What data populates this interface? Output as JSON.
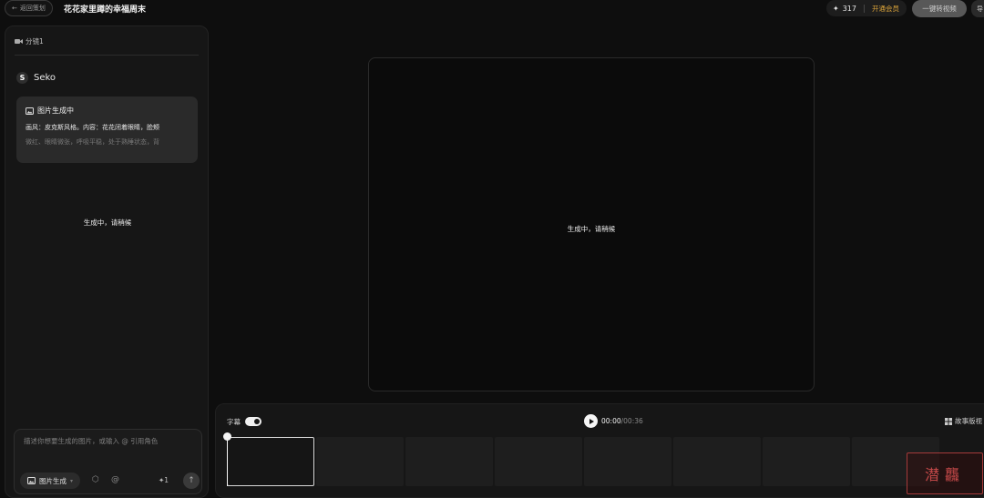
{
  "header": {
    "back_label": "返回策划",
    "project_title": "花花家里蹲的幸福周末",
    "credits": "317",
    "member_label": "开通会员",
    "convert_label": "一键转视频",
    "edge_label": "导"
  },
  "left_panel": {
    "shot_tab": "分镜1",
    "assistant_name": "Seko",
    "generation_card": {
      "title": "图片生成中",
      "line1": "画风：皮克斯风格。内容：花花闭着眼睛，脸颊",
      "line2": "微红、眼睛微张，呼吸平稳，处于熟睡状态，背"
    },
    "status": "生成中，请稍候",
    "prompt": {
      "placeholder": "描述你想要生成的图片，或输入 @ 引用角色",
      "mode_label": "图片生成",
      "cost": "1"
    }
  },
  "preview": {
    "status": "生成中，请稍候"
  },
  "timeline": {
    "subtitle_label": "字幕",
    "subtitle_on": true,
    "current_time": "00:00",
    "total_time": "/00:36",
    "storyboard_label": "故事版视"
  },
  "watermark_text": "潜龘",
  "colors": {
    "accent_member": "#e0a73a",
    "background": "#0e0e0e",
    "panel": "#161616"
  },
  "icons": {
    "back": "arrow-left-icon",
    "credits": "sparkle-icon",
    "shot": "video-camera-icon",
    "seko": "seko-logo-icon",
    "image": "image-icon",
    "play": "play-icon",
    "send": "arrow-up-icon",
    "storyboard": "grid-icon"
  }
}
